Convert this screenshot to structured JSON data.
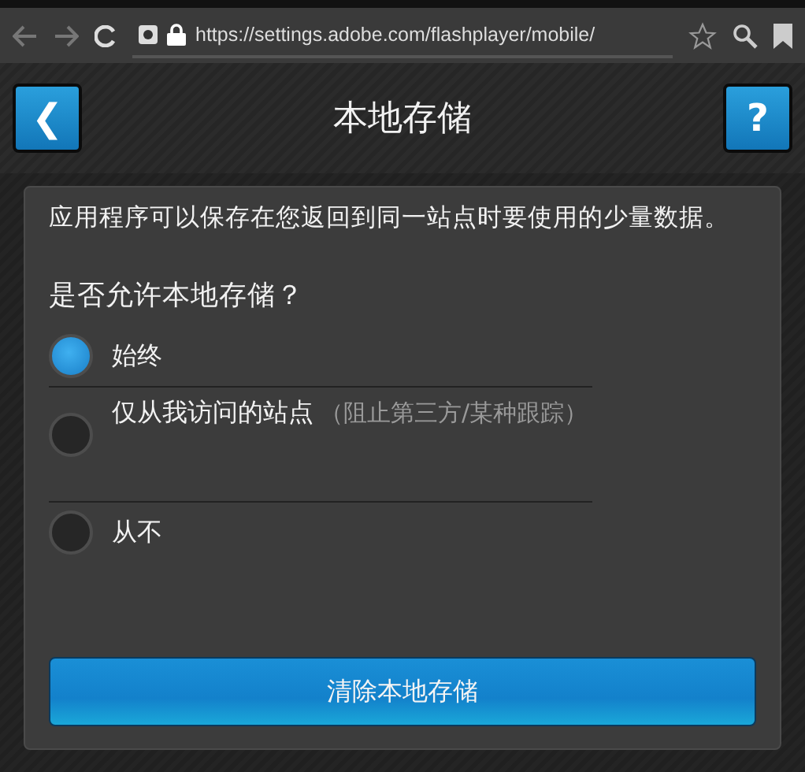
{
  "browser": {
    "url": "https://settings.adobe.com/flashplayer/mobile/"
  },
  "header": {
    "title": "本地存储",
    "back_label": "❮",
    "help_label": "?"
  },
  "panel": {
    "description": "应用程序可以保存在您返回到同一站点时要使用的少量数据。",
    "question": "是否允许本地存储？",
    "options": [
      {
        "label": "始终",
        "selected": true
      },
      {
        "label": "仅从我访问的站点",
        "note": "（阻止第三方/某种跟踪）",
        "selected": false
      },
      {
        "label": "从不",
        "selected": false
      }
    ],
    "button": "清除本地存储"
  }
}
